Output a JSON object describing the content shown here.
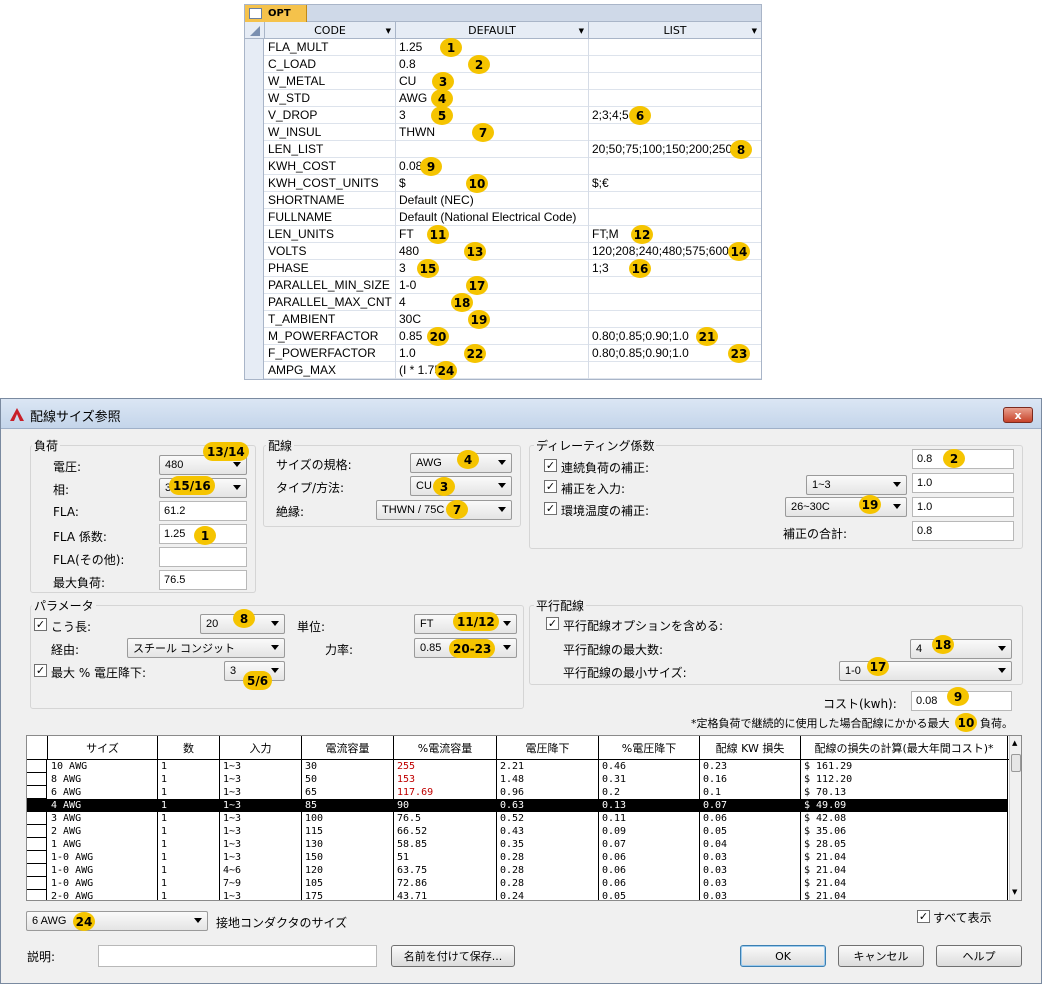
{
  "opt_table": {
    "tab_label": "OPT",
    "columns": [
      "CODE",
      "DEFAULT",
      "LIST"
    ],
    "rows": [
      {
        "code": "FLA_MULT",
        "default": "1.25",
        "list": "",
        "badge": "1",
        "list_badge": ""
      },
      {
        "code": "C_LOAD",
        "default": "0.8",
        "list": "",
        "badge": "2",
        "list_badge": ""
      },
      {
        "code": "W_METAL",
        "default": "CU",
        "list": "",
        "badge": "3",
        "list_badge": ""
      },
      {
        "code": "W_STD",
        "default": "AWG",
        "list": "",
        "badge": "4",
        "list_badge": ""
      },
      {
        "code": "V_DROP",
        "default": "3",
        "list": "2;3;4;5",
        "badge": "5",
        "list_badge": "6"
      },
      {
        "code": "W_INSUL",
        "default": "THWN",
        "list": "",
        "badge": "7",
        "list_badge": ""
      },
      {
        "code": "LEN_LIST",
        "default": "",
        "list": "20;50;75;100;150;200;250",
        "badge": "",
        "list_badge": "8"
      },
      {
        "code": "KWH_COST",
        "default": "0.08",
        "list": "",
        "badge": "9",
        "list_badge": ""
      },
      {
        "code": "KWH_COST_UNITS",
        "default": "$",
        "list": "$;€",
        "badge": "10",
        "list_badge": ""
      },
      {
        "code": "SHORTNAME",
        "default": "Default (NEC)",
        "list": "",
        "badge": "",
        "list_badge": ""
      },
      {
        "code": "FULLNAME",
        "default": "Default (National Electrical Code)",
        "list": "",
        "badge": "",
        "list_badge": ""
      },
      {
        "code": "LEN_UNITS",
        "default": "FT",
        "list": "FT;M",
        "badge": "11",
        "list_badge": "12"
      },
      {
        "code": "VOLTS",
        "default": "480",
        "list": "120;208;240;480;575;600",
        "badge": "13",
        "list_badge": "14"
      },
      {
        "code": "PHASE",
        "default": "3",
        "list": "1;3",
        "badge": "15",
        "list_badge": "16"
      },
      {
        "code": "PARALLEL_MIN_SIZE",
        "default": "1-0",
        "list": "",
        "badge": "17",
        "list_badge": ""
      },
      {
        "code": "PARALLEL_MAX_CNT",
        "default": "4",
        "list": "",
        "badge": "18",
        "list_badge": ""
      },
      {
        "code": "T_AMBIENT",
        "default": "30C",
        "list": "",
        "badge": "19",
        "list_badge": ""
      },
      {
        "code": "M_POWERFACTOR",
        "default": "0.85",
        "list": "0.80;0.85;0.90;1.0",
        "badge": "20",
        "list_badge": "21"
      },
      {
        "code": "F_POWERFACTOR",
        "default": "1.0",
        "list": "0.80;0.85;0.90;1.0",
        "badge": "22",
        "list_badge": "23"
      },
      {
        "code": "AMPG_MAX",
        "default": "(I * 1.75)",
        "list": "",
        "badge": "24",
        "list_badge": ""
      }
    ]
  },
  "dialog": {
    "title": "配線サイズ参照",
    "close_label": "x",
    "load": {
      "group_label": "負荷",
      "voltage_label": "電圧:",
      "voltage_value": "480",
      "voltage_badge": "13/14",
      "phase_label": "相:",
      "phase_value": "3",
      "phase_badge": "15/16",
      "fla_label": "FLA:",
      "fla_value": "61.2",
      "fla_factor_label": "FLA 係数:",
      "fla_factor_value": "1.25",
      "fla_factor_badge": "1",
      "fla_other_label": "FLA(その他):",
      "fla_other_value": "",
      "max_load_label": "最大負荷:",
      "max_load_value": "76.5"
    },
    "wiring": {
      "group_label": "配線",
      "standard_label": "サイズの規格:",
      "standard_value": "AWG",
      "standard_badge": "4",
      "type_label": "タイプ/方法:",
      "type_value": "CU",
      "type_badge": "3",
      "insulation_label": "絶縁:",
      "insulation_value": "THWN / 75C",
      "insulation_badge": "7"
    },
    "derating": {
      "group_label": "ディレーティング係数",
      "continuous_label": "連続負荷の補正:",
      "continuous_value": "0.8",
      "continuous_badge": "2",
      "input_label": "補正を入力:",
      "input_combo": "1~3",
      "input_value": "1.0",
      "temp_label": "環境温度の補正:",
      "temp_combo": "26~30C",
      "temp_value": "1.0",
      "temp_badge": "19",
      "total_label": "補正の合計:",
      "total_value": "0.8"
    },
    "params": {
      "group_label": "パラメータ",
      "length_label": "こう長:",
      "length_value": "20",
      "length_badge": "8",
      "route_label": "経由:",
      "route_value": "スチール コンジット",
      "vdrop_label": "最大 % 電圧降下:",
      "vdrop_value": "3",
      "vdrop_badge": "5/6",
      "unit_label": "単位:",
      "unit_value": "FT",
      "unit_badge": "11/12",
      "pf_label": "力率:",
      "pf_value": "0.85",
      "pf_badge": "20-23"
    },
    "parallel": {
      "group_label": "平行配線",
      "include_label": "平行配線オプションを含める:",
      "max_label": "平行配線の最大数:",
      "max_value": "4",
      "max_badge": "18",
      "min_label": "平行配線の最小サイズ:",
      "min_value": "1-0",
      "min_badge": "17"
    },
    "cost_label": "コスト(kwh):",
    "cost_value": "0.08",
    "cost_badge": "9",
    "note_prefix": "*定格負荷で継続的に使用した場合配線にかかる最大",
    "note_suffix": "負荷。",
    "note_badge": "10",
    "grid": {
      "columns": [
        "サイズ",
        "数",
        "入力",
        "電流容量",
        "%電流容量",
        "電圧降下",
        "%電圧降下",
        "配線 KW 損失",
        "配線の損失の計算(最大年間コスト)*"
      ],
      "rows": [
        [
          "10 AWG",
          "1",
          "1~3",
          "30",
          "255",
          "2.21",
          "0.46",
          "0.23",
          "$ 161.29"
        ],
        [
          "8 AWG",
          "1",
          "1~3",
          "50",
          "153",
          "1.48",
          "0.31",
          "0.16",
          "$ 112.20"
        ],
        [
          "6 AWG",
          "1",
          "1~3",
          "65",
          "117.69",
          "0.96",
          "0.2",
          "0.1",
          "$ 70.13"
        ],
        [
          "4 AWG",
          "1",
          "1~3",
          "85",
          "90",
          "0.63",
          "0.13",
          "0.07",
          "$ 49.09"
        ],
        [
          "3 AWG",
          "1",
          "1~3",
          "100",
          "76.5",
          "0.52",
          "0.11",
          "0.06",
          "$ 42.08"
        ],
        [
          "2 AWG",
          "1",
          "1~3",
          "115",
          "66.52",
          "0.43",
          "0.09",
          "0.05",
          "$ 35.06"
        ],
        [
          "1 AWG",
          "1",
          "1~3",
          "130",
          "58.85",
          "0.35",
          "0.07",
          "0.04",
          "$ 28.05"
        ],
        [
          "1-0 AWG",
          "1",
          "1~3",
          "150",
          "51",
          "0.28",
          "0.06",
          "0.03",
          "$ 21.04"
        ],
        [
          "1-0 AWG",
          "1",
          "4~6",
          "120",
          "63.75",
          "0.28",
          "0.06",
          "0.03",
          "$ 21.04"
        ],
        [
          "1-0 AWG",
          "1",
          "7~9",
          "105",
          "72.86",
          "0.28",
          "0.06",
          "0.03",
          "$ 21.04"
        ],
        [
          "2-0 AWG",
          "1",
          "1~3",
          "175",
          "43.71",
          "0.24",
          "0.05",
          "0.03",
          "$ 21.04"
        ]
      ]
    },
    "ground_value": "6 AWG",
    "ground_badge": "24",
    "ground_label": "接地コンダクタのサイズ",
    "show_all_label": "すべて表示",
    "description_label": "説明:",
    "description_value": "",
    "save_as_label": "名前を付けて保存...",
    "ok_label": "OK",
    "cancel_label": "キャンセル",
    "help_label": "ヘルプ"
  }
}
